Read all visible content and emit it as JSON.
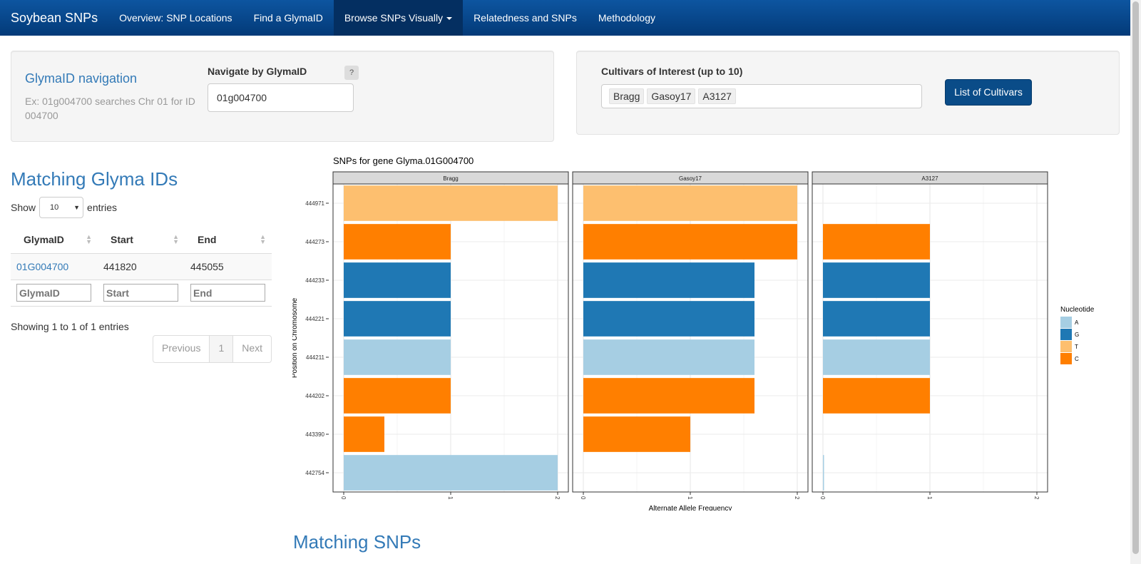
{
  "navbar": {
    "brand": "Soybean SNPs",
    "items": [
      {
        "label": "Overview: SNP Locations"
      },
      {
        "label": "Find a GlymaID"
      },
      {
        "label": "Browse SNPs Visually"
      },
      {
        "label": "Relatedness and SNPs"
      },
      {
        "label": "Methodology"
      }
    ],
    "active_index": 2
  },
  "glyma_nav": {
    "title": "GlymaID navigation",
    "help_text": "Ex: 01g004700 searches Chr 01 for ID 004700",
    "label": "Navigate by GlymaID",
    "help_button": "?",
    "value": "01g004700"
  },
  "cultivars": {
    "label": "Cultivars of Interest (up to 10)",
    "selected": [
      "Bragg",
      "Gasoy17",
      "A3127"
    ],
    "button": "List of Cultivars"
  },
  "matching_ids": {
    "heading": "Matching Glyma IDs",
    "show_label": "Show",
    "entries_label": "entries",
    "page_size": "10",
    "columns": [
      "GlymaID",
      "Start",
      "End"
    ],
    "rows": [
      [
        "01G004700",
        "441820",
        "445055"
      ]
    ],
    "filters": [
      "GlymaID",
      "Start",
      "End"
    ],
    "info": "Showing 1 to 1 of 1 entries",
    "pagination": {
      "previous": "Previous",
      "page": "1",
      "next": "Next"
    }
  },
  "matching_snps": {
    "heading": "Matching SNPs"
  },
  "chart_data": {
    "type": "bar",
    "orientation": "horizontal",
    "title": "SNPs for gene Glyma.01G004700",
    "xlabel": "Alternate Allele Frequency",
    "ylabel": "Position on Chromosome",
    "xlim": [
      0,
      2
    ],
    "x_ticks": [
      0,
      1,
      2
    ],
    "categories": [
      "444971",
      "444273",
      "444233",
      "444221",
      "444211",
      "444202",
      "443390",
      "442754"
    ],
    "legend": {
      "title": "Nucleotide",
      "placement": "right",
      "items": [
        {
          "label": "A",
          "color": "#a6cee3"
        },
        {
          "label": "G",
          "color": "#1f78b4"
        },
        {
          "label": "T",
          "color": "#fdbf6f"
        },
        {
          "label": "C",
          "color": "#ff7f00"
        }
      ]
    },
    "panels": [
      {
        "name": "Bragg",
        "values": [
          2.0,
          1.0,
          1.0,
          1.0,
          1.0,
          1.0,
          0.38,
          2.0
        ],
        "nucleotides": [
          "T",
          "C",
          "G",
          "G",
          "A",
          "C",
          "C",
          "A"
        ]
      },
      {
        "name": "Gasoy17",
        "values": [
          2.0,
          2.0,
          1.6,
          1.6,
          1.6,
          1.6,
          1.0,
          0
        ],
        "nucleotides": [
          "T",
          "C",
          "G",
          "G",
          "A",
          "C",
          "C",
          "A"
        ]
      },
      {
        "name": "A3127",
        "values": [
          0,
          1.0,
          1.0,
          1.0,
          1.0,
          1.0,
          0,
          0.01
        ],
        "nucleotides": [
          "T",
          "C",
          "G",
          "G",
          "A",
          "C",
          "C",
          "A"
        ]
      }
    ]
  }
}
